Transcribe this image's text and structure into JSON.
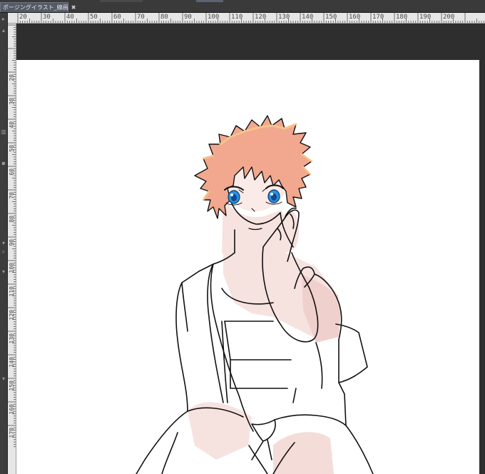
{
  "app": {
    "document_tab": {
      "title": "ポージングイラスト_線画",
      "close_glyph": "✖"
    }
  },
  "ruler": {
    "horizontal_labels": [
      "20",
      "30",
      "40",
      "50",
      "60",
      "70",
      "80",
      "90",
      "100",
      "110",
      "120",
      "130",
      "140",
      "150",
      "160",
      "170",
      "180",
      "190",
      "200"
    ],
    "vertical_labels": [
      "20",
      "30",
      "40",
      "50",
      "60",
      "70",
      "80",
      "90",
      "100",
      "110",
      "120",
      "130",
      "140",
      "150",
      "160",
      "170"
    ]
  },
  "left_panel": {
    "icons": [
      "panel-handle-icon",
      "scroll-up-icon",
      "trash-icon",
      "lock-icon",
      "scroll-down-icon",
      "search-icon",
      "collapse-icon"
    ]
  },
  "canvas": {
    "paper_color": "#ffffff",
    "workspace_color": "#2e2e2e",
    "hair_color": "#f1a88e",
    "hair_highlight": "#f7c38e",
    "skin_color": "#f6e2df",
    "skin_shadow": "#efcfcb",
    "eye_color": "#2a8fe0",
    "line_color": "#111111"
  }
}
